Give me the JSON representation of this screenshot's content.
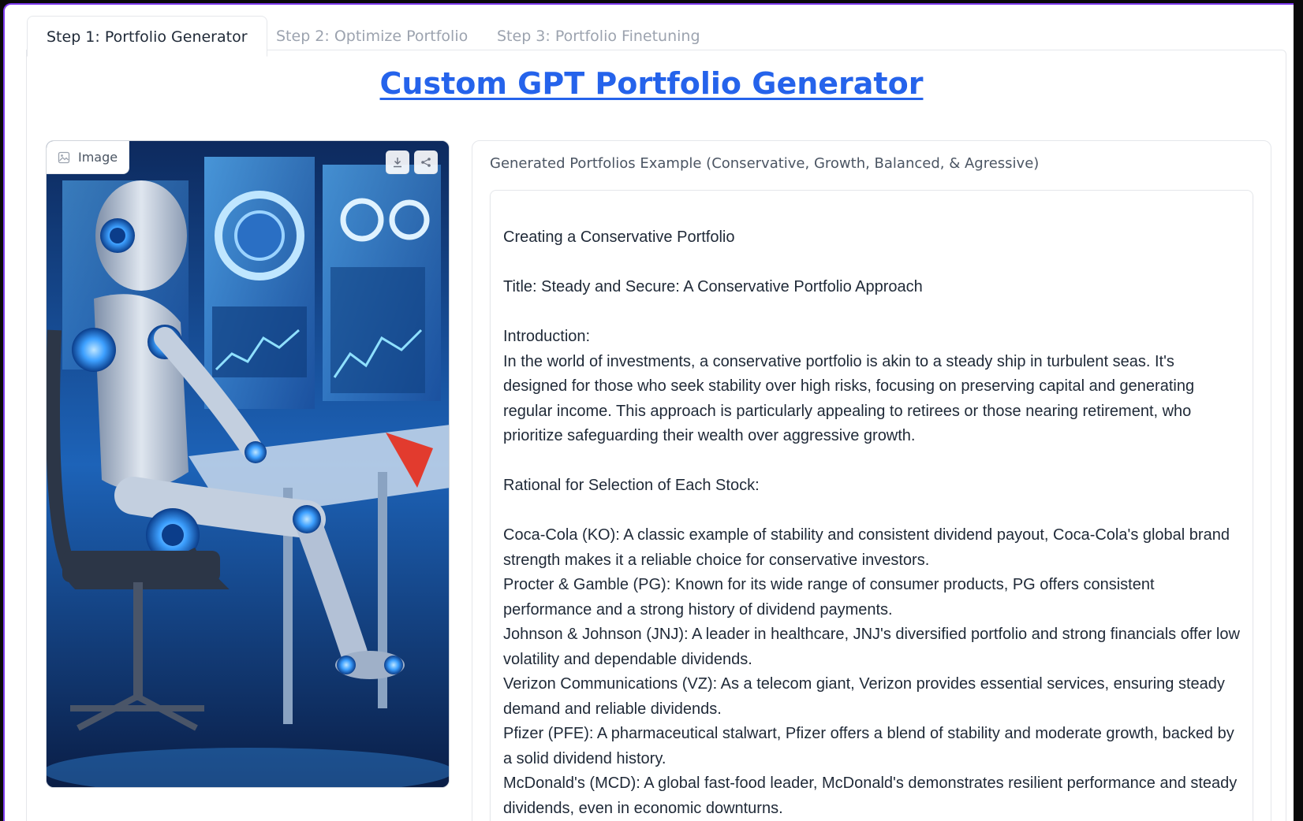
{
  "tabs": [
    {
      "label": "Step 1: Portfolio Generator",
      "active": true
    },
    {
      "label": "Step 2: Optimize Portfolio",
      "active": false
    },
    {
      "label": "Step 3: Portfolio Finetuning",
      "active": false
    }
  ],
  "title": "Custom GPT Portfolio Generator",
  "image_panel": {
    "label": "Image",
    "icons": [
      "image-icon",
      "download-icon",
      "share-icon"
    ]
  },
  "output_panel": {
    "label": "Generated Portfolios Example (Conservative, Growth, Balanced, & Agressive)",
    "paragraphs": [
      "Creating a Conservative Portfolio",
      "Title: Steady and Secure: A Conservative Portfolio Approach",
      "Introduction:",
      "In the world of investments, a conservative portfolio is akin to a steady ship in turbulent seas. It's designed for those who seek stability over high risks, focusing on preserving capital and generating regular income. This approach is particularly appealing to retirees or those nearing retirement, who prioritize safeguarding their wealth over aggressive growth.",
      "Rational for Selection of Each Stock:",
      "Coca-Cola (KO): A classic example of stability and consistent dividend payout, Coca-Cola's global brand strength makes it a reliable choice for conservative investors.",
      "Procter & Gamble (PG): Known for its wide range of consumer products, PG offers consistent performance and a strong history of dividend payments.",
      "Johnson & Johnson (JNJ): A leader in healthcare, JNJ's diversified portfolio and strong financials offer low volatility and dependable dividends.",
      "Verizon Communications (VZ): As a telecom giant, Verizon provides essential services, ensuring steady demand and reliable dividends.",
      "Pfizer (PFE): A pharmaceutical stalwart, Pfizer offers a blend of stability and moderate growth, backed by a solid dividend history.",
      "McDonald's (MCD): A global fast-food leader, McDonald's demonstrates resilient performance and steady dividends, even in economic downturns."
    ]
  },
  "colors": {
    "accent": "#7c3aed",
    "title": "#2563eb"
  }
}
